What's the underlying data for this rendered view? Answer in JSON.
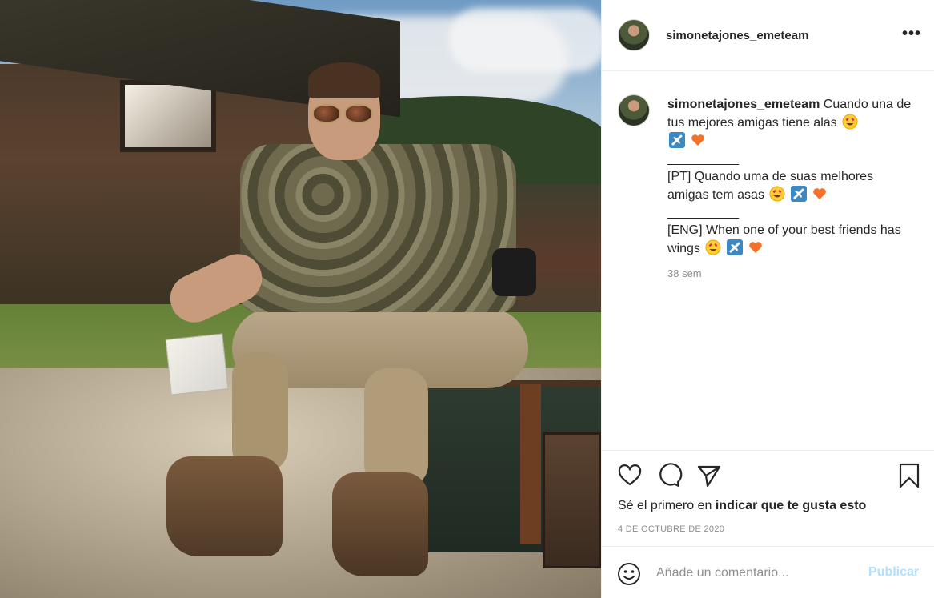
{
  "post": {
    "username": "simonetajones_emeteam",
    "more_label": "•••"
  },
  "caption": {
    "username": "simonetajones_emeteam",
    "line1": "Cuando una de tus mejores amigas tiene alas",
    "separator1": "__________",
    "pt_text": "[PT] Quando uma de suas melhores amigas tem asas",
    "separator2": "__________",
    "eng_text": "[ENG] When one of your best friends has wings",
    "time": "38 sem"
  },
  "icons": {
    "heart_eyes": "heart-eyes-emoji",
    "airplane": "airplane-emoji",
    "heart": "orange-heart-emoji",
    "like": "heart-icon",
    "comment": "comment-icon",
    "share": "paper-plane-icon",
    "save": "bookmark-icon",
    "emoji_picker": "smiley-icon"
  },
  "likes": {
    "prefix": "Sé el primero en ",
    "link": "indicar que te gusta esto"
  },
  "date": "4 DE OCTUBRE DE 2020",
  "comment": {
    "placeholder": "Añade un comentario...",
    "publish_label": "Publicar"
  },
  "colors": {
    "text": "#262626",
    "secondary": "#8e8e8e",
    "publish_disabled": "#b2dffc",
    "divider": "#efefef"
  }
}
